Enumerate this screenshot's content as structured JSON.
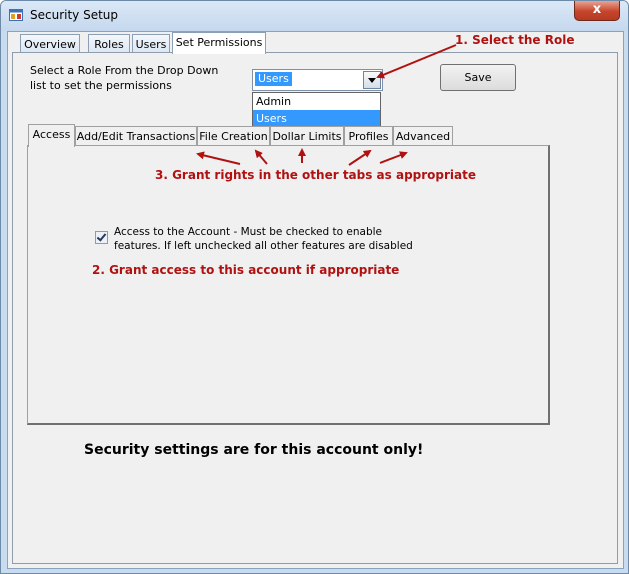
{
  "window": {
    "title": "Security Setup",
    "close_glyph": "x"
  },
  "main_tabs": [
    {
      "label": "Overview"
    },
    {
      "label": "Roles"
    },
    {
      "label": "Users"
    },
    {
      "label": "Set Permissions",
      "active": true
    }
  ],
  "role": {
    "label": "Select a Role From the Drop Down list to set the permissions",
    "selected": "Users",
    "options": [
      "Admin",
      "Users"
    ]
  },
  "save_label": "Save",
  "sub_tabs": [
    {
      "label": "Access",
      "active": true
    },
    {
      "label": "Add/Edit Transactions"
    },
    {
      "label": "File Creation"
    },
    {
      "label": "Dollar Limits"
    },
    {
      "label": "Profiles"
    },
    {
      "label": "Advanced"
    }
  ],
  "access": {
    "checkbox_checked": true,
    "checkbox_label": "Access to the Account - Must be checked to enable features.  If left unchecked all other features are disabled"
  },
  "annotations": {
    "step1": "1. Select the Role",
    "step2": "2. Grant access to this account if appropriate",
    "step3": "3. Grant rights in the other tabs as appropriate"
  },
  "footer_note": "Security settings are for this account only!",
  "colors": {
    "annotation": "#b01212",
    "selection": "#3399ff",
    "close_button": "#c6452b"
  },
  "icons": {
    "app": "app-window-icon",
    "dropdown": "chevron-down-icon",
    "checkbox": "checkmark-icon"
  }
}
